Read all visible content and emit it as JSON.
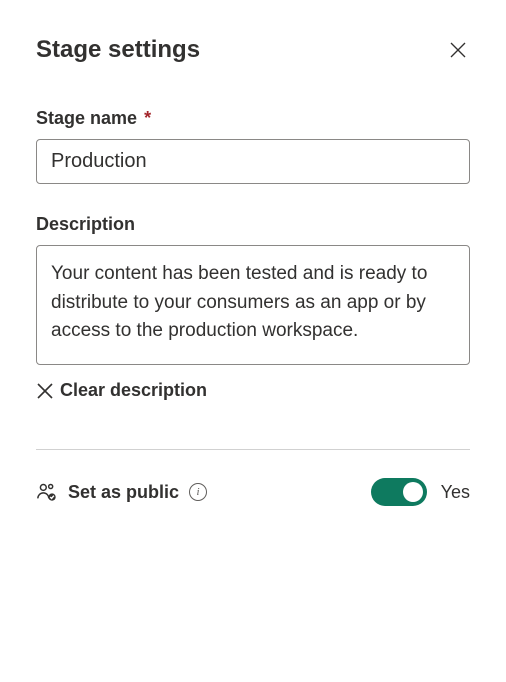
{
  "header": {
    "title": "Stage settings"
  },
  "stage_name": {
    "label": "Stage name",
    "required_mark": "*",
    "value": "Production"
  },
  "description": {
    "label": "Description",
    "value": "Your content has been tested and is ready to distribute to your consumers as an app or by access to the production workspace.",
    "clear_label": "Clear description"
  },
  "public": {
    "label": "Set as public",
    "toggle_state_label": "Yes"
  },
  "colors": {
    "toggle_on": "#0e7a5f"
  }
}
